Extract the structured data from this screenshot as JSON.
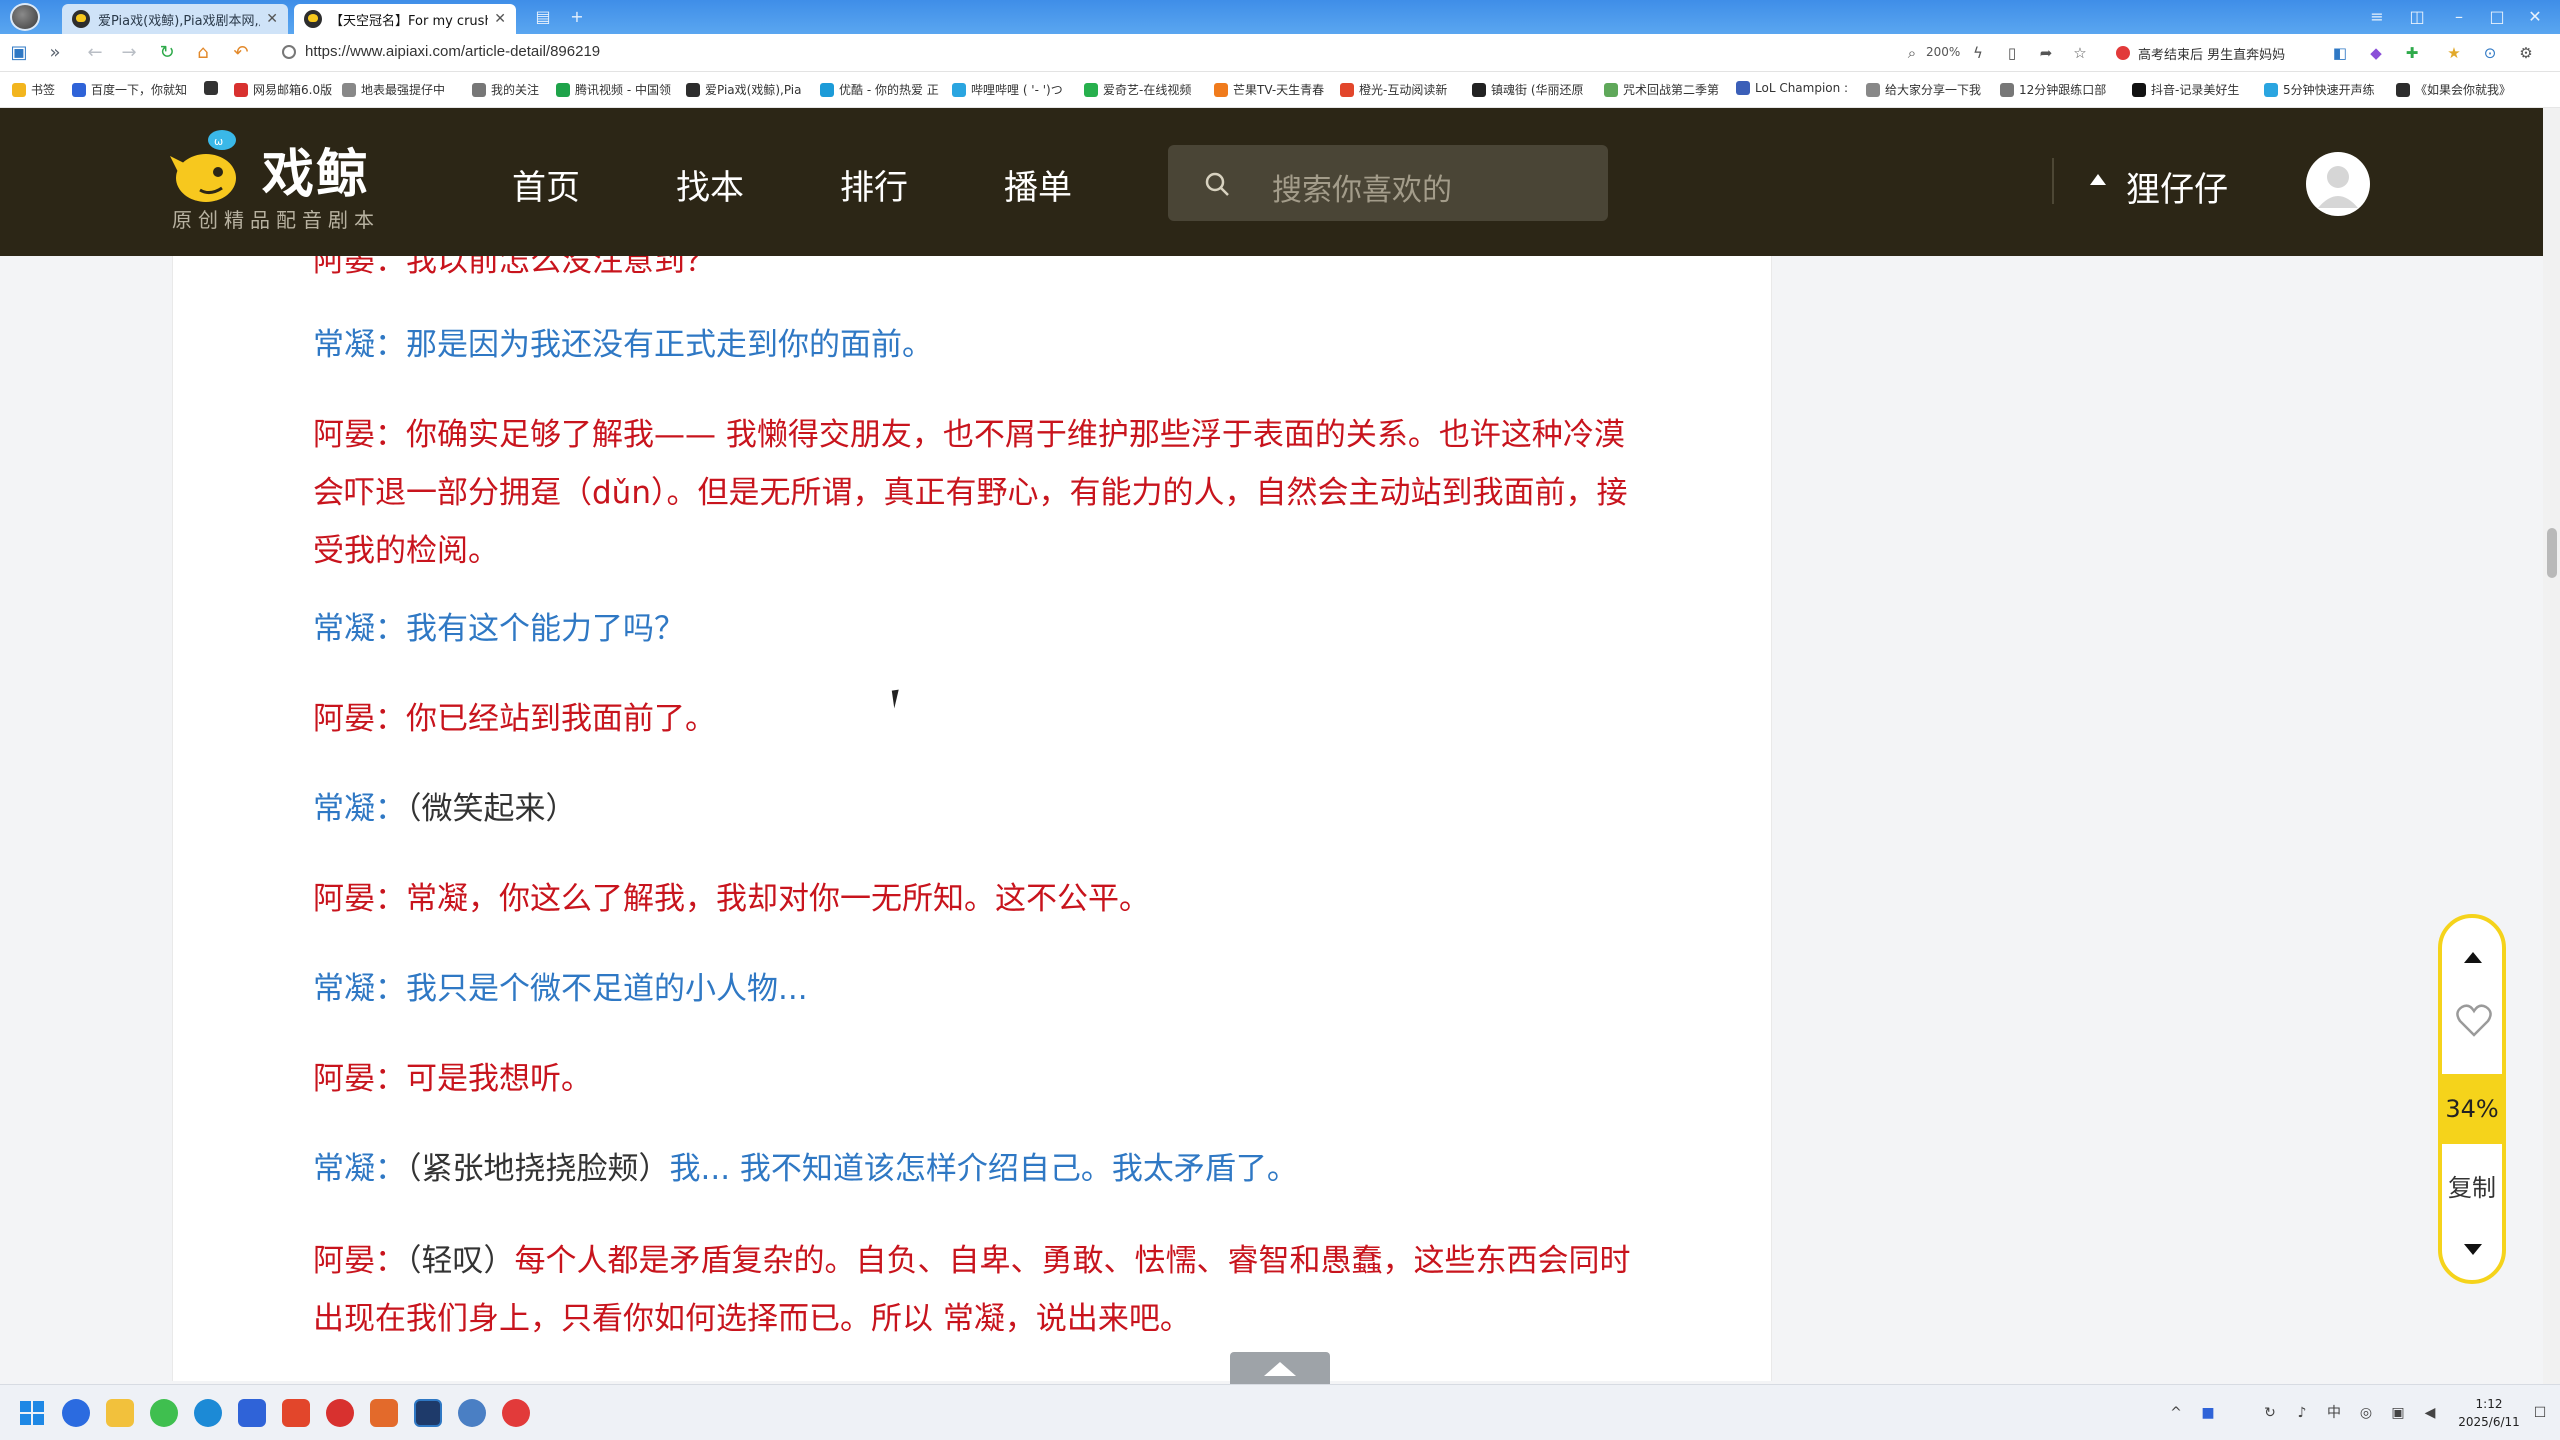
{
  "browser": {
    "tabs": [
      {
        "title": "爱Pia戏(戏鲸),Pia戏剧本网,广告",
        "active": false
      },
      {
        "title": "【天空冠名】For my crush -",
        "active": true
      }
    ],
    "url": "https://www.aipiaxi.com/article-detail/896219",
    "zoom": "200%",
    "news": "高考结束后 男生直奔妈妈",
    "bookmarks": [
      "书签",
      "百度一下，你就知",
      "",
      "网易邮箱6.0版",
      "地表最强提仔中",
      "我的关注",
      "腾讯视频 - 中国领",
      "爱Pia戏(戏鲸),Pia",
      "优酷 - 你的热爱 正",
      "哔哩哔哩 ( '- ')つ",
      "爱奇艺-在线视频",
      "芒果TV-天生青春",
      "橙光-互动阅读新",
      "镇魂街 (华丽还原",
      "咒术回战第二季第",
      "LoL Champion :",
      "给大家分享一下我",
      "12分钟跟练口部",
      "抖音-记录美好生",
      "5分钟快速开声练",
      "《如果会你就我》"
    ]
  },
  "site": {
    "logo_name": "戏鲸",
    "slogan": "原创精品配音剧本",
    "nav": [
      "首页",
      "找本",
      "排行",
      "播单"
    ],
    "search_placeholder": "搜索你喜欢的",
    "username": "狸仔仔"
  },
  "script_lines": [
    {
      "speaker": "阿晏",
      "text": "我以前怎么没注意到？",
      "color": "red"
    },
    {
      "speaker": "常凝",
      "text": "那是因为我还没有正式走到你的面前。",
      "color": "blue"
    },
    {
      "speaker": "阿晏",
      "text": "你确实足够了解我—— 我懒得交朋友，也不屑于维护那些浮于表面的关系。也许这种冷漠会吓退一部分拥趸（dǔn）。但是无所谓，真正有野心，有能力的人，自然会主动站到我面前，接受我的检阅。",
      "color": "red"
    },
    {
      "speaker": "常凝",
      "text": "我有这个能力了吗？",
      "color": "blue"
    },
    {
      "speaker": "阿晏",
      "text": "你已经站到我面前了。",
      "color": "red"
    },
    {
      "speaker": "常凝",
      "stage": "（微笑起来）",
      "text": "",
      "color": "blue"
    },
    {
      "speaker": "阿晏",
      "text": "常凝，你这么了解我，我却对你一无所知。这不公平。",
      "color": "red"
    },
    {
      "speaker": "常凝",
      "text": "我只是个微不足道的小人物...",
      "color": "blue"
    },
    {
      "speaker": "阿晏",
      "text": "可是我想听。",
      "color": "red"
    },
    {
      "speaker": "常凝",
      "stage": "（紧张地挠挠脸颊）",
      "text": "我... 我不知道该怎样介绍自己。我太矛盾了。",
      "color": "blue"
    },
    {
      "speaker": "阿晏",
      "stage": "（轻叹）",
      "text": "每个人都是矛盾复杂的。自负、自卑、勇敢、怯懦、睿智和愚蠢，这些东西会同时出现在我们身上，只看你如何选择而已。所以 常凝，说出来吧。",
      "color": "red"
    }
  ],
  "float_bar": {
    "progress": "34%",
    "copy_label": "复制"
  },
  "colors": {
    "red_speaker": "#c8141d",
    "blue_speaker": "#2f78c4",
    "accent_yellow": "#f5d31b",
    "header_bg": "#2c2616"
  },
  "taskbar": {
    "time": "1:12",
    "date": "2025/6/11"
  }
}
